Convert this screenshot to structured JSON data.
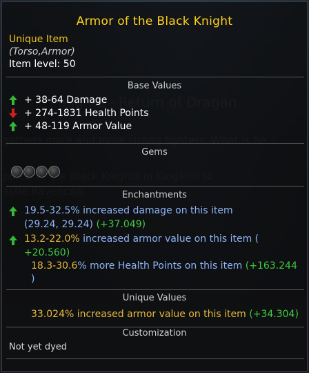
{
  "item": {
    "name": "Armor of the Black Knight",
    "rarity": "Unique Item",
    "slot": "(Torso,Armor)",
    "level_label": "Item level:",
    "level_value": "50"
  },
  "sections": {
    "base_values": "Base Values",
    "gems": "Gems",
    "enchantments": "Enchantments",
    "unique_values": "Unique Values",
    "customization": "Customization"
  },
  "base_values": [
    {
      "direction": "up",
      "text": "+ 38-64 Damage"
    },
    {
      "direction": "down",
      "text": "+ 274-1831 Health Points"
    },
    {
      "direction": "up",
      "text": "+ 48-119 Armor Value"
    }
  ],
  "gem_slots": 4,
  "enchantments": {
    "e1_line1_range": "19.5-32.5%",
    "e1_line1_text": " increased damage on this item",
    "e1_line2_values": "(29.24, 29.24)",
    "e1_line2_bonus": "(+37.049)",
    "e2_line1_range": "13.2-22.0%",
    "e2_line1_text": " increased armor value on this item (",
    "e2_line2_bonus": "+20.560)",
    "e3_line1_range": "18.3-30.6",
    "e3_line1_text": "% more Health Points on this item ",
    "e3_line1_bonus": "(+163.244",
    "e3_line2": ")"
  },
  "unique": {
    "value": "33.024",
    "text": "% increased armor value on this item ",
    "bonus": "(+34.304)"
  },
  "customization_text": "Not yet dyed",
  "colors": {
    "title": "#ffd21a",
    "arrow_up": "#35b835",
    "arrow_down": "#d02020",
    "enchant_blue": "#8fb4f5",
    "bonus_green": "#42c942",
    "value_orange": "#e6b83c"
  }
}
